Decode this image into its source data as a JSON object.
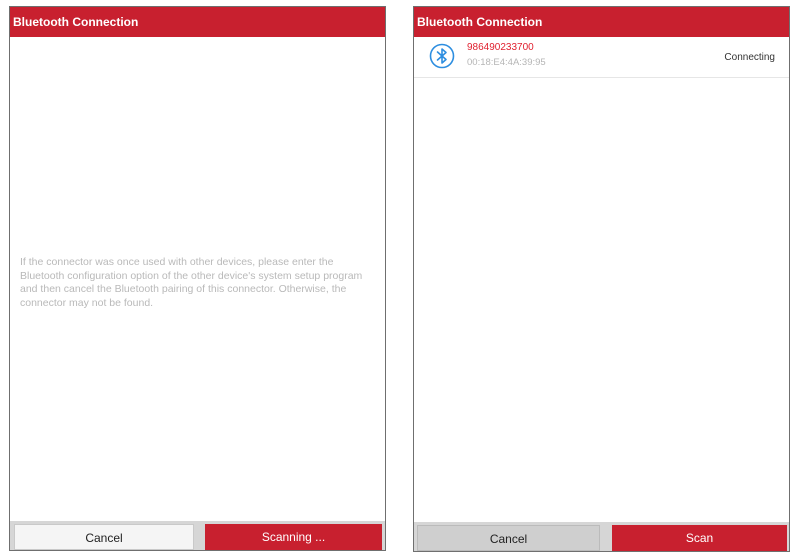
{
  "left_panel": {
    "title": "Bluetooth Connection",
    "message": "If the connector was once used with other devices, please enter the Bluetooth configuration option of the other device's system setup program and then cancel the Bluetooth pairing of this connector. Otherwise, the connector may not be found.",
    "cancel_label": "Cancel",
    "scan_label": "Scanning ..."
  },
  "right_panel": {
    "title": "Bluetooth Connection",
    "device": {
      "name": "986490233700",
      "mac": "00:18:E4:4A:39:95",
      "status": "Connecting",
      "icon": "bluetooth-icon"
    },
    "cancel_label": "Cancel",
    "scan_label": "Scan"
  },
  "colors": {
    "brand_red": "#c8202f",
    "icon_blue": "#2d8ee0"
  }
}
